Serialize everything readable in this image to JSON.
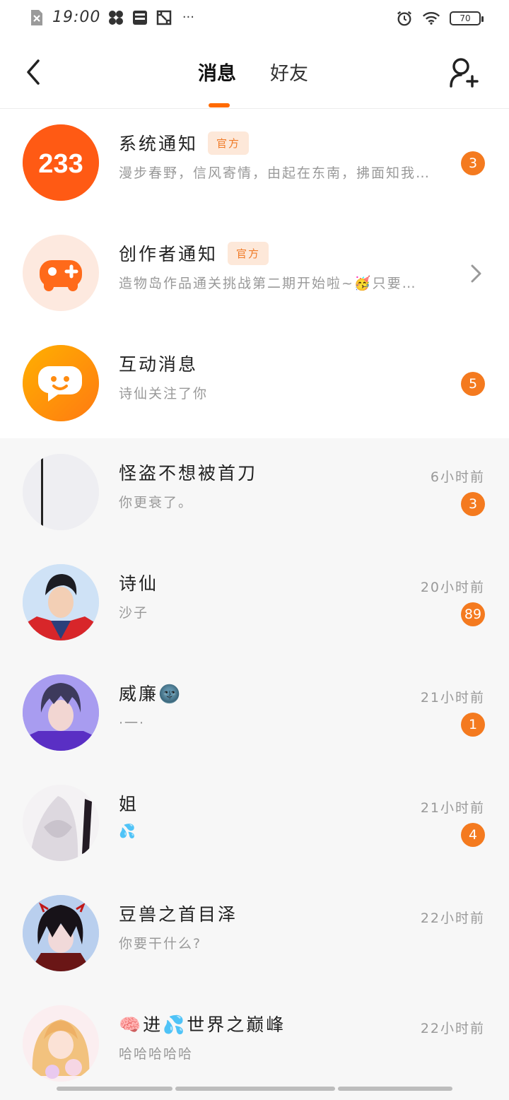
{
  "status_bar": {
    "time": "19:00",
    "battery": "70",
    "more": "···"
  },
  "nav": {
    "tab_messages": "消息",
    "tab_friends": "好友"
  },
  "official": [
    {
      "title": "系统通知",
      "tag": "官方",
      "subtitle": "漫步春野，信风寄情，由起在东南，拂面知我…",
      "badge": "3",
      "avatar_text": "233",
      "avatar_color": "#ff5a14"
    },
    {
      "title": "创作者通知",
      "tag": "官方",
      "subtitle": "造物岛作品通关挑战第二期开始啦~🥳只要…",
      "avatar_color": "#fde9df"
    },
    {
      "title": "互动消息",
      "subtitle": "诗仙关注了你",
      "badge": "5",
      "avatar_color": "#ff9a12"
    }
  ],
  "chats": [
    {
      "name": "怪盗不想被首刀",
      "message": "你更衰了。",
      "time": "6小时前",
      "badge": "3"
    },
    {
      "name": "诗仙",
      "message": "沙子",
      "time": "20小时前",
      "badge": "89"
    },
    {
      "name": "威廉🌚",
      "message": "·一·",
      "time": "21小时前",
      "badge": "1"
    },
    {
      "name": "姐",
      "message": "💦",
      "time": "21小时前",
      "badge": "4"
    },
    {
      "name": "豆兽之首目泽",
      "message": "你要干什么?",
      "time": "22小时前"
    },
    {
      "name": "🧠进💦世界之巅峰",
      "message": "哈哈哈哈哈",
      "time": "22小时前"
    }
  ],
  "colors": {
    "accent": "#f47a1f",
    "official_tag_bg": "#fde8d9"
  }
}
